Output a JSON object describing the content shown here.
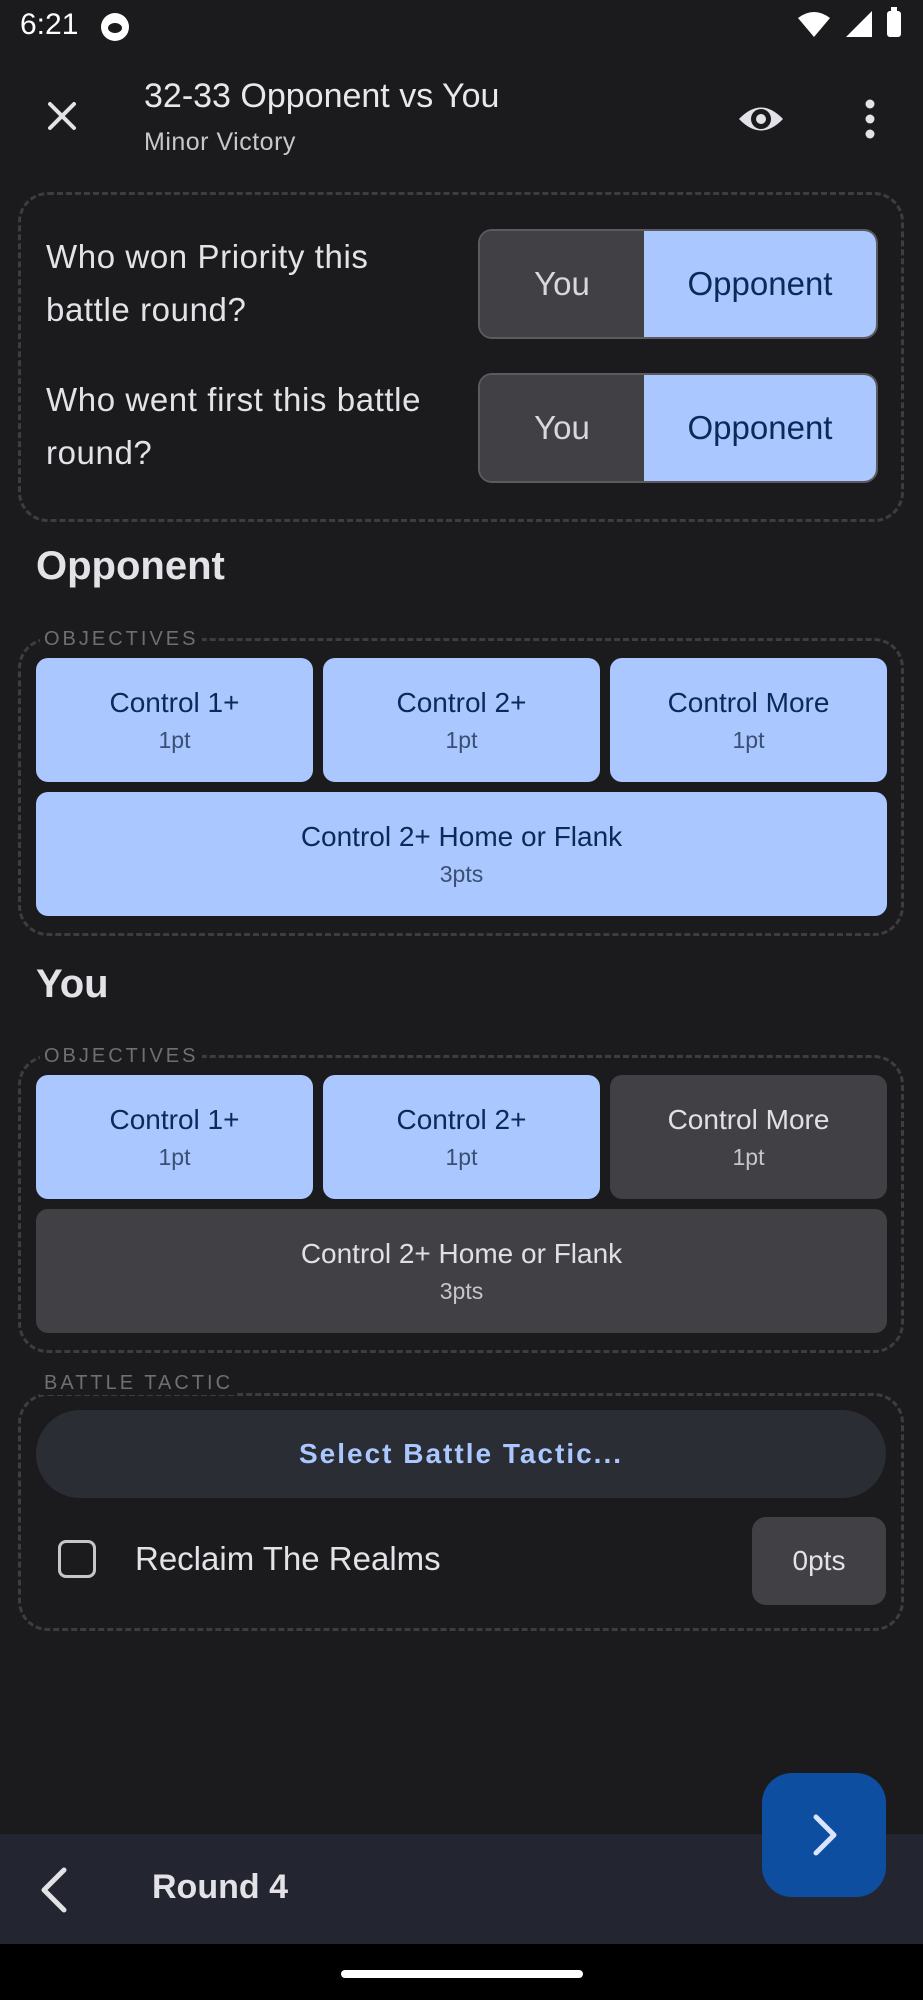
{
  "status_bar": {
    "time": "6:21"
  },
  "app_bar": {
    "title": "32-33 Opponent vs You",
    "subtitle": "Minor Victory"
  },
  "priority": {
    "question": "Who won Priority this battle round?",
    "options": [
      "You",
      "Opponent"
    ],
    "selected": "Opponent"
  },
  "first_turn": {
    "question": "Who went first this battle round?",
    "options": [
      "You",
      "Opponent"
    ],
    "selected": "Opponent"
  },
  "opponent": {
    "heading": "Opponent",
    "objectives_label": "OBJECTIVES",
    "objectives": [
      {
        "label": "Control 1+",
        "points": "1pt",
        "selected": true
      },
      {
        "label": "Control 2+",
        "points": "1pt",
        "selected": true
      },
      {
        "label": "Control More",
        "points": "1pt",
        "selected": true
      },
      {
        "label": "Control 2+ Home or Flank",
        "points": "3pts",
        "selected": true
      }
    ]
  },
  "you": {
    "heading": "You",
    "objectives_label": "OBJECTIVES",
    "objectives": [
      {
        "label": "Control 1+",
        "points": "1pt",
        "selected": true
      },
      {
        "label": "Control 2+",
        "points": "1pt",
        "selected": true
      },
      {
        "label": "Control More",
        "points": "1pt",
        "selected": false
      },
      {
        "label": "Control 2+ Home or Flank",
        "points": "3pts",
        "selected": false
      }
    ]
  },
  "battle_tactic": {
    "label": "BATTLE TACTIC",
    "select_button": "Select Battle Tactic...",
    "item_label": "Reclaim The Realms",
    "item_checked": false,
    "item_points": "0pts"
  },
  "bottom_bar": {
    "round": "Round 4"
  },
  "colors": {
    "accent": "#aac7ff",
    "background": "#1b1b1e",
    "fab": "#0e4ea0"
  }
}
